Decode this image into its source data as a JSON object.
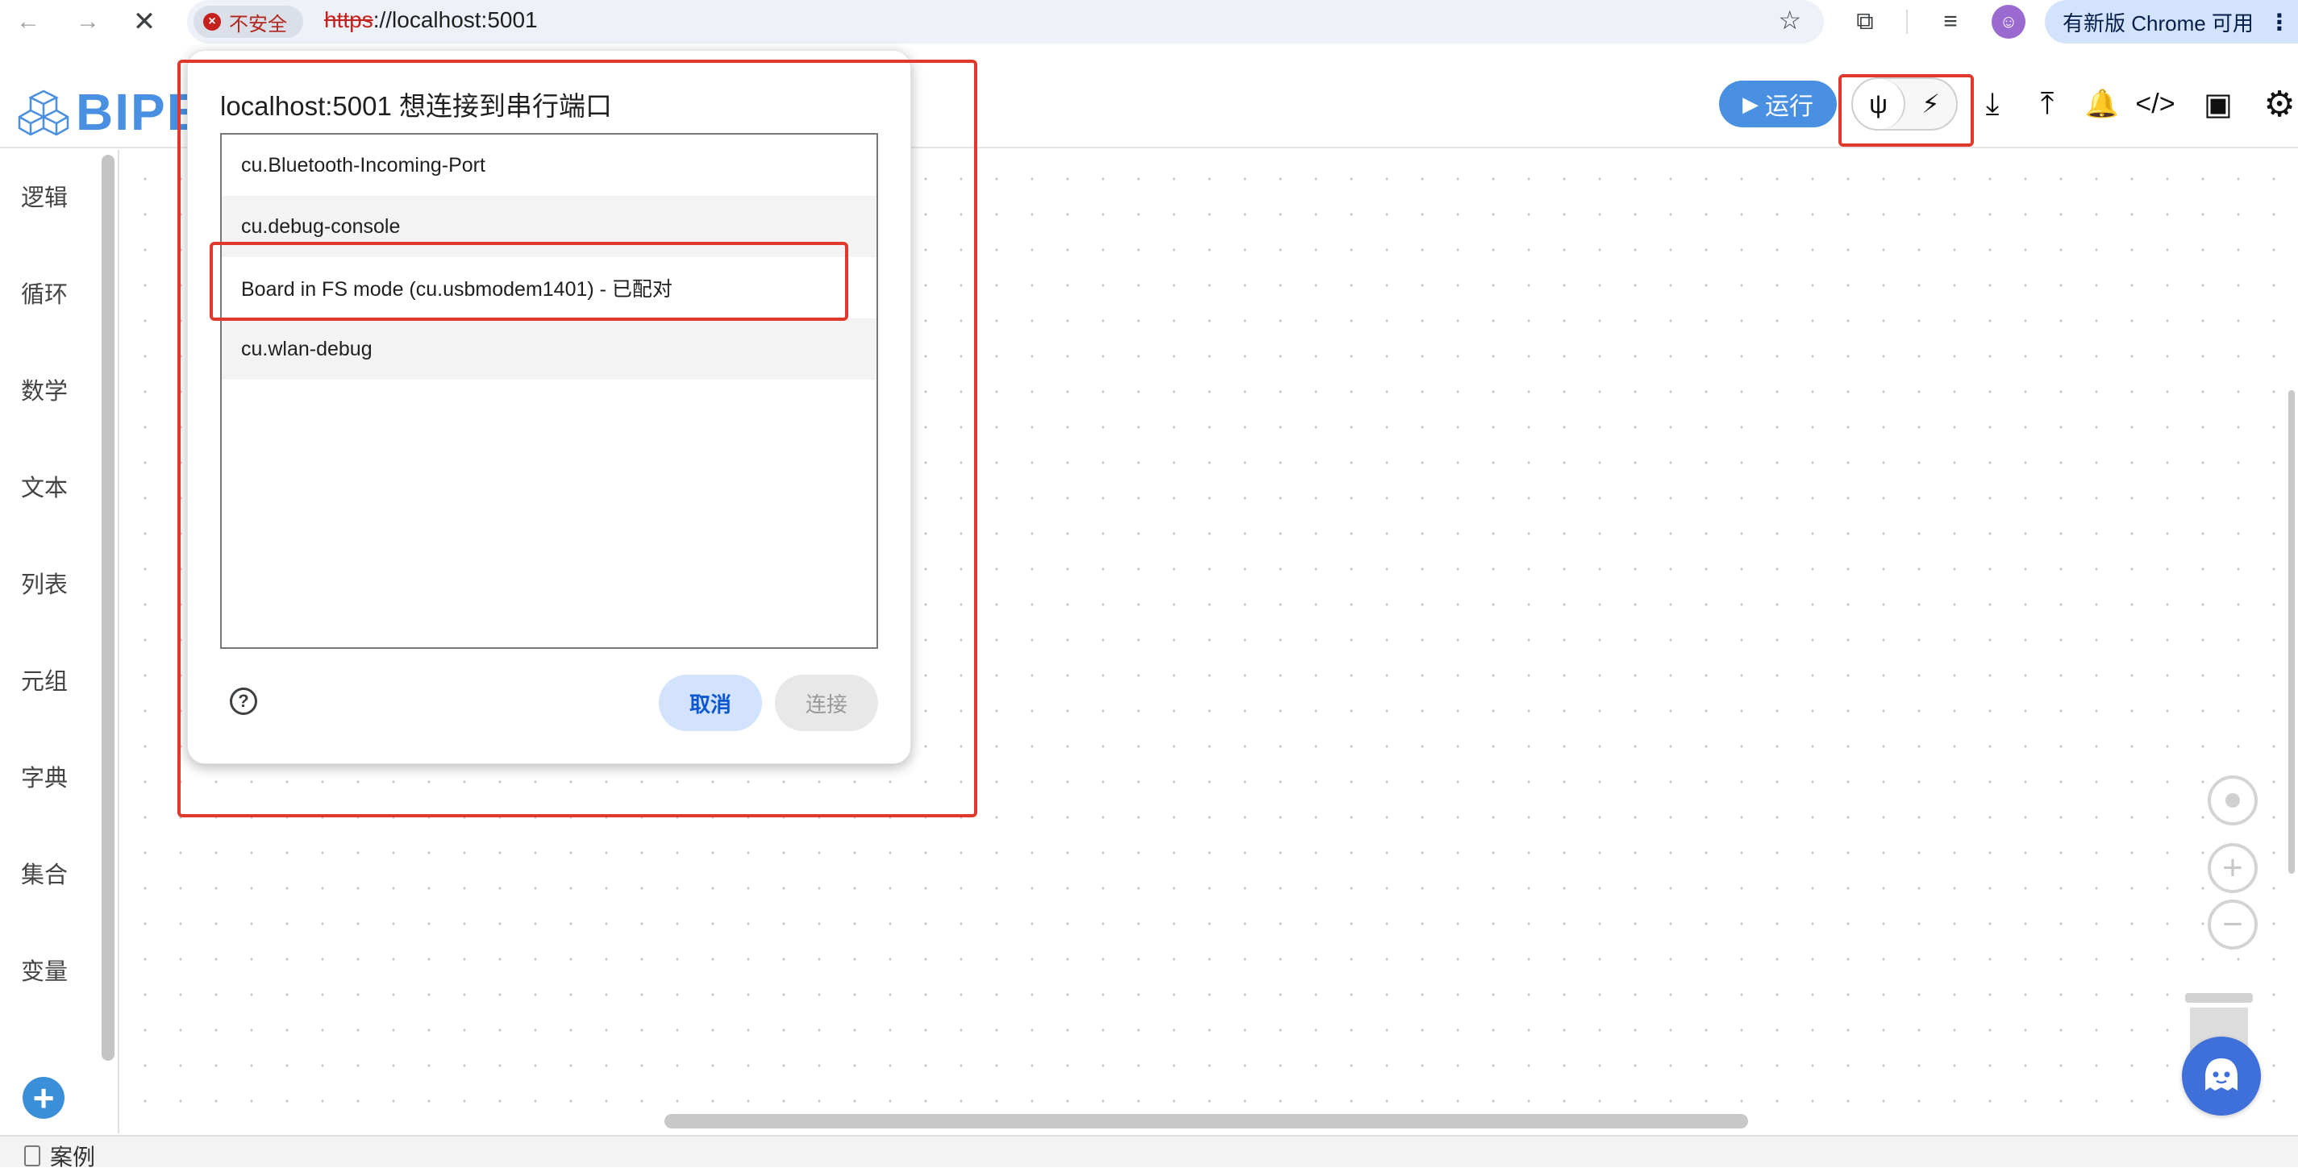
{
  "browser": {
    "back_icon": "←",
    "forward_icon": "→",
    "stop_icon": "✕",
    "security_label": "不安全",
    "url_scheme": "https",
    "url_rest": "://localhost:5001",
    "star_icon": "☆",
    "extensions_icon": "⧉",
    "media_icon": "≡",
    "update_label": "有新版 Chrome 可用",
    "menu_icon": "⋮"
  },
  "app": {
    "logo_text": "BIPES",
    "run_label": "运行",
    "usb_icon": "ψ",
    "disconnect_icon": "⚡",
    "download_icon": "⤓",
    "upload_icon": "⤒",
    "bell_icon": "🔔",
    "code_icon": "</>",
    "console_icon": "▣",
    "settings_icon": "⚙"
  },
  "sidebar": {
    "categories": [
      {
        "label": "逻辑"
      },
      {
        "label": "循环"
      },
      {
        "label": "数学"
      },
      {
        "label": "文本"
      },
      {
        "label": "列表"
      },
      {
        "label": "元组"
      },
      {
        "label": "字典"
      },
      {
        "label": "集合"
      },
      {
        "label": "变量"
      }
    ],
    "add_label": "+"
  },
  "footer": {
    "examples_label": "案例"
  },
  "dialog": {
    "title": "localhost:5001 想连接到串行端口",
    "ports": [
      {
        "label": "cu.Bluetooth-Incoming-Port"
      },
      {
        "label": "cu.debug-console"
      },
      {
        "label": "Board in FS mode (cu.usbmodem1401) - 已配对"
      },
      {
        "label": "cu.wlan-debug"
      }
    ],
    "help_icon": "?",
    "cancel_label": "取消",
    "connect_label": "连接"
  },
  "workspace": {
    "zoom_in": "+",
    "zoom_out": "−"
  },
  "colors": {
    "accent": "#4a90e2",
    "highlight": "#e0382a",
    "cancel_bg": "#d3e3fd"
  }
}
